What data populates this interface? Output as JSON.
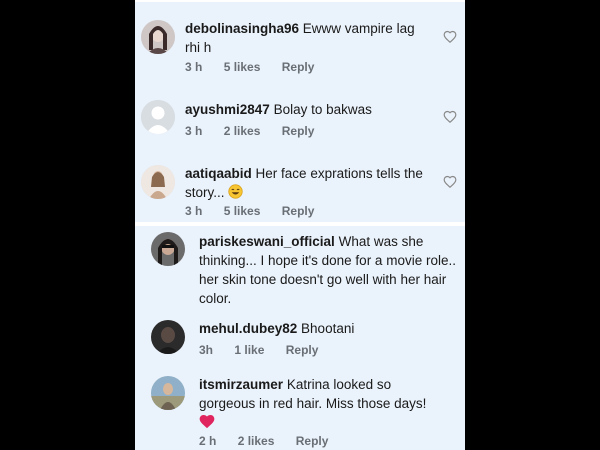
{
  "top_panel": {
    "comments": [
      {
        "username": "debolinasingha96",
        "text": "Ewww vampire lag rhi h",
        "time": "3 h",
        "likes": "5 likes",
        "reply": "Reply",
        "avatar": "profile-photo-woman"
      },
      {
        "username": "ayushmi2847",
        "text": "Bolay to bakwas",
        "time": "3 h",
        "likes": "2 likes",
        "reply": "Reply",
        "avatar": "default-avatar"
      },
      {
        "username": "aatiqaabid",
        "text": "Her face exprations tells the story...",
        "emoji": "laughing-emoji",
        "time": "3 h",
        "likes": "5 likes",
        "reply": "Reply",
        "avatar": "profile-photo-woman"
      }
    ]
  },
  "bottom_panel": {
    "comments": [
      {
        "username": "pariskeswani_official",
        "text": "What was she thinking... I hope it's done for a movie role.. her skin tone doesn't go well with her hair color.",
        "avatar": "profile-photo-woman-dark"
      },
      {
        "username": "mehul.dubey82",
        "text": "Bhootani",
        "time": "3h",
        "likes": "1 like",
        "reply": "Reply",
        "avatar": "profile-photo-dark"
      },
      {
        "username": "itsmirzaumer",
        "text": "Katrina looked so gorgeous in red hair. Miss those days!",
        "emoji": "red-heart-emoji",
        "time": "2 h",
        "likes": "2 likes",
        "reply": "Reply",
        "avatar": "profile-photo-outdoor"
      }
    ]
  },
  "colors": {
    "panel_bg": "#eaf2fb",
    "heart_emoji": "#e0245e",
    "meta_text": "#6a6f75"
  }
}
